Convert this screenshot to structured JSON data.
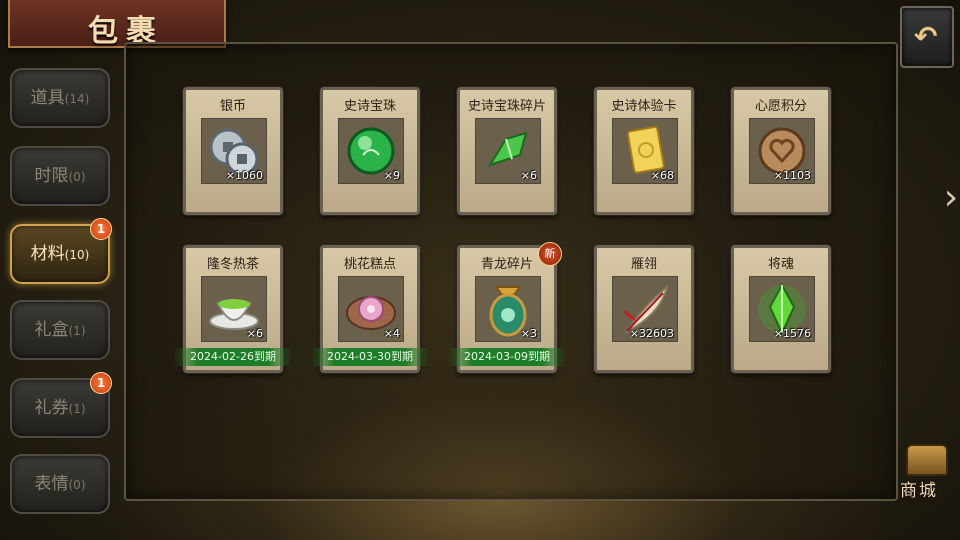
{
  "title": "包裹",
  "back_icon": "back-arrow-icon",
  "tabs": [
    {
      "label": "道具",
      "count": "(14)",
      "badge": "",
      "active": false
    },
    {
      "label": "时限",
      "count": "(0)",
      "badge": "",
      "active": false
    },
    {
      "label": "材料",
      "count": "(10)",
      "badge": "1",
      "active": true
    },
    {
      "label": "礼盒",
      "count": "(1)",
      "badge": "",
      "active": false
    },
    {
      "label": "礼券",
      "count": "(1)",
      "badge": "1",
      "active": false
    },
    {
      "label": "表情",
      "count": "(0)",
      "badge": "",
      "active": false
    }
  ],
  "items": [
    {
      "name": "银币",
      "qty": "×1060",
      "icon": "silver-coin-icon",
      "expiry": "",
      "new": ""
    },
    {
      "name": "史诗宝珠",
      "qty": "×9",
      "icon": "green-orb-icon",
      "expiry": "",
      "new": ""
    },
    {
      "name": "史诗宝珠碎片",
      "qty": "×6",
      "icon": "green-shard-icon",
      "expiry": "",
      "new": ""
    },
    {
      "name": "史诗体验卡",
      "qty": "×68",
      "icon": "gold-card-icon",
      "expiry": "",
      "new": ""
    },
    {
      "name": "心愿积分",
      "qty": "×1103",
      "icon": "heart-coin-icon",
      "expiry": "",
      "new": ""
    },
    {
      "name": "隆冬热茶",
      "qty": "×6",
      "icon": "tea-cup-icon",
      "expiry": "2024-02-26到期",
      "new": ""
    },
    {
      "name": "桃花糕点",
      "qty": "×4",
      "icon": "peach-cake-icon",
      "expiry": "2024-03-30到期",
      "new": ""
    },
    {
      "name": "青龙碎片",
      "qty": "×3",
      "icon": "dragon-jade-icon",
      "expiry": "2024-03-09到期",
      "new": "新"
    },
    {
      "name": "雁翎",
      "qty": "×32603",
      "icon": "feather-icon",
      "expiry": "",
      "new": ""
    },
    {
      "name": "将魂",
      "qty": "×1576",
      "icon": "green-crystal-icon",
      "expiry": "",
      "new": ""
    }
  ],
  "shop": {
    "label": "商城",
    "icon": "treasure-chest-icon"
  },
  "side_arrow_icon": "chevron-right-icon"
}
